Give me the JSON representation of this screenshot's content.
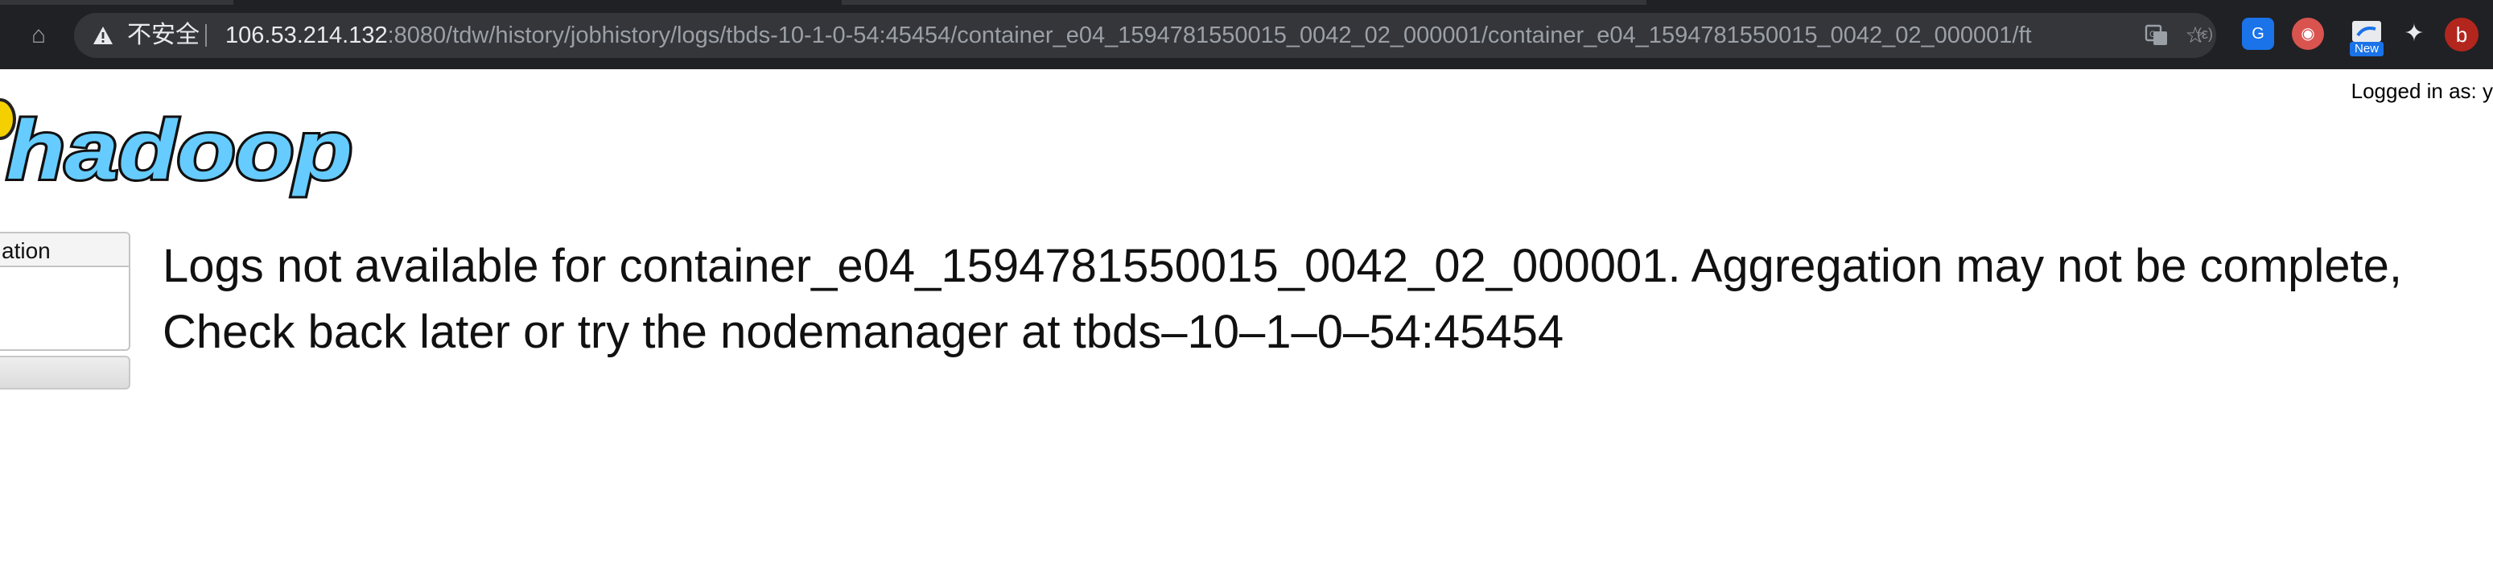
{
  "browser": {
    "security_label": "不安全",
    "url_host": "106.53.214.132",
    "url_rest": ":8080/tdw/history/jobhistory/logs/tbds-10-1-0-54:45454/container_e04_1594781550015_0042_02_000001/container_e04_1594781550015_0042_02_000001/ft",
    "new_badge": "New",
    "profile_initial": "b",
    "colors": {
      "chrome_bg": "#202124",
      "omnibox_bg": "#35363a",
      "profile": "#b3261e"
    }
  },
  "page": {
    "logged_in": "Logged in as: y",
    "logo_text": "hadoop",
    "nav_title": "ation",
    "message_line1": "Logs not available for container_e04_1594781550015_0042_02_000001. Aggregation may not be complete,",
    "message_line2": "Check back later or try the nodemanager at tbds–10–1–0–54:45454"
  }
}
